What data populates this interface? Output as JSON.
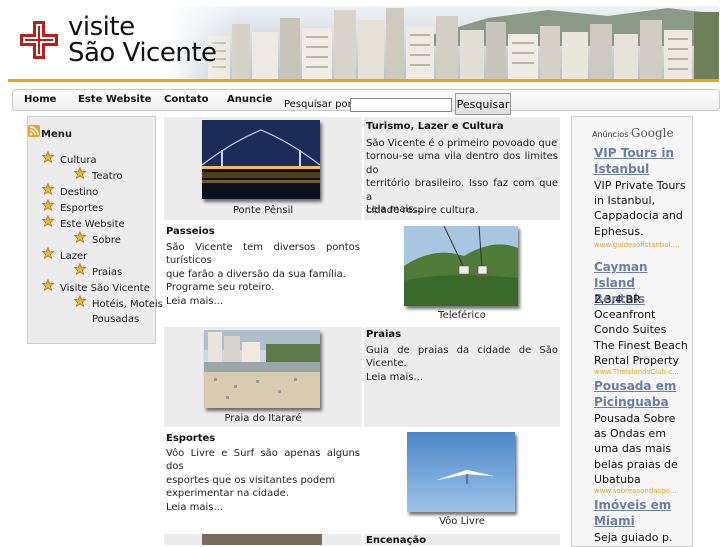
{
  "header": {
    "logo_line1": "visite",
    "logo_line2": "São Vicente",
    "accent_color": "#e8a320",
    "cross_color": "#c21b1b"
  },
  "nav": {
    "items": [
      "Home",
      "Este Website",
      "Contato",
      "Anuncie"
    ]
  },
  "search": {
    "label": "Pesquisar por:",
    "value": "",
    "button": "Pesquisar"
  },
  "menu": {
    "title": "Menu",
    "items": [
      {
        "label": "Cultura"
      },
      {
        "label": "Teatro"
      },
      {
        "label": "Destino"
      },
      {
        "label": "Esportes"
      },
      {
        "label": "Este Website"
      },
      {
        "label": "Sobre"
      },
      {
        "label": "Lazer"
      },
      {
        "label": "Praias"
      },
      {
        "label": "Visite São Vicente"
      },
      {
        "label": "Hotéis, Moteis,"
      },
      {
        "label": "Pousadas"
      }
    ]
  },
  "content": {
    "ponte": {
      "caption": "Ponte Pênsil"
    },
    "turismo": {
      "title": "Turismo, Lazer e Cultura",
      "lines": [
        "São Vicente é o primeiro povoado que",
        "tornou-se uma vila dentro dos limites do",
        "território brasileiro. Isso faz com que a",
        "cidade respire cultura."
      ],
      "more": "Leia mais..."
    },
    "passeios": {
      "title": "Passeios",
      "lines": [
        "São Vicente tem diversos pontos turísticos",
        "que farão a diversão da sua família.",
        "Programe seu roteiro."
      ],
      "more": "Leia mais..."
    },
    "teleferico": {
      "caption": "Teleférico"
    },
    "itarare": {
      "caption": "Praia do Itararé"
    },
    "praias": {
      "title": "Praias",
      "lines": [
        "Guia de praias da cidade de São Vicente."
      ],
      "more": "Leia mais..."
    },
    "esportes": {
      "title": "Esportes",
      "lines": [
        "Vôo Livre e Surf são apenas alguns dos",
        "esportes que os visitantes podem",
        "experimentar na cidade."
      ],
      "more": "Leia mais..."
    },
    "voo": {
      "caption": "Vôo Livre"
    },
    "encenacao": {
      "title": "Encenação"
    }
  },
  "ads": {
    "label": "Anúncios",
    "brand": "Google",
    "items": [
      {
        "title_lines": [
          "VIP Tours in",
          "Istanbul"
        ],
        "text_lines": [
          "VIP Private Tours",
          "in Istanbul,",
          "Cappadocia and",
          "Ephesus."
        ],
        "url": "www.guidesofistanbul...."
      },
      {
        "title_lines": [
          "Cayman Island",
          "Rentals"
        ],
        "text_lines": [
          "2,3,4 BR",
          "Oceanfront",
          "Condo Suites",
          "The Finest Beach",
          "Rental Property"
        ],
        "url": "www.TheIslandsClub.c..."
      },
      {
        "title_lines": [
          "Pousada em",
          "Picinguaba"
        ],
        "text_lines": [
          "Pousada Sobre",
          "as Ondas em",
          "uma das mais",
          "belas praias de",
          "Ubatuba"
        ],
        "url": "www.sobreasondaspo..."
      },
      {
        "title_lines": [
          "Imóveis em",
          "Miami"
        ],
        "text_lines": [
          "Seja guiado p."
        ],
        "url": ""
      }
    ]
  }
}
